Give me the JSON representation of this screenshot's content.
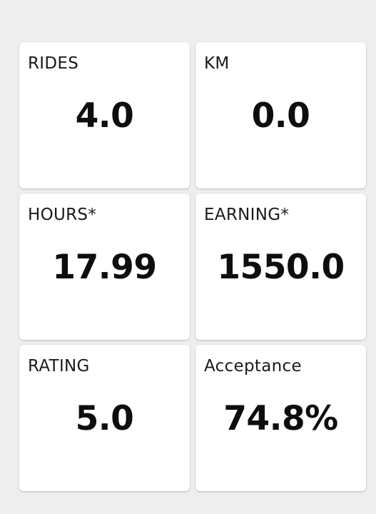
{
  "stats": {
    "rides": {
      "label": "RIDES",
      "value": "4.0"
    },
    "km": {
      "label": "KM",
      "value": "0.0"
    },
    "hours": {
      "label": "HOURS*",
      "value": "17.99"
    },
    "earning": {
      "label": "EARNING*",
      "value": "1550.0"
    },
    "rating": {
      "label": "RATING",
      "value": "5.0"
    },
    "acceptance": {
      "label": "Acceptance",
      "value": "74.8%"
    }
  },
  "colors": {
    "background": "#eeeeee",
    "card": "#ffffff",
    "text": "#111111"
  }
}
